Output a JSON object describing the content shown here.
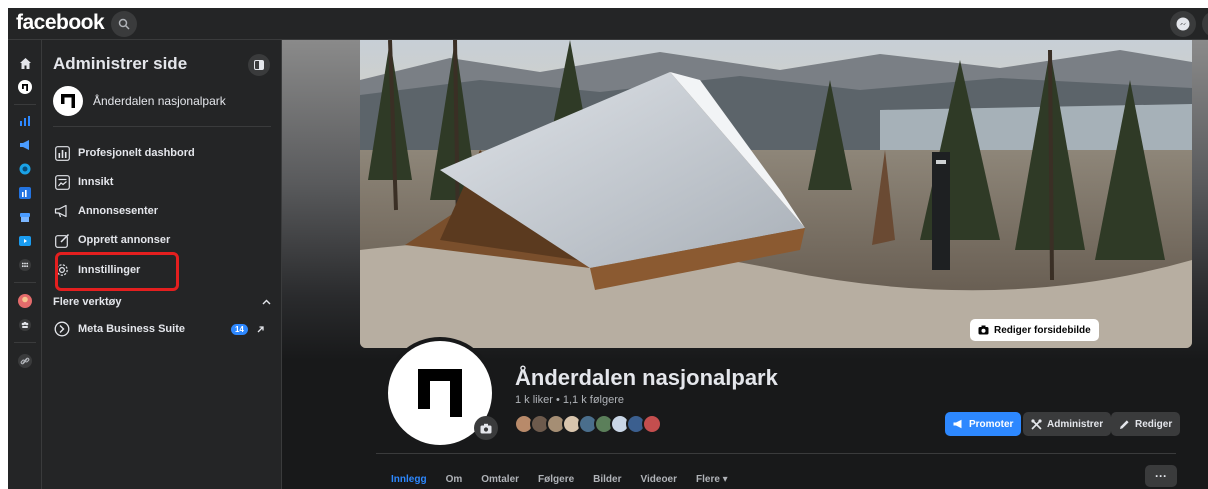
{
  "topbar": {
    "logo": "facebook"
  },
  "panel": {
    "title": "Administrer side",
    "page_name": "Ånderdalen nasjonalpark",
    "menu": [
      {
        "label": "Profesjonelt dashbord",
        "icon": "dashboard-icon"
      },
      {
        "label": "Innsikt",
        "icon": "insights-icon"
      },
      {
        "label": "Annonsesenter",
        "icon": "megaphone-icon"
      },
      {
        "label": "Opprett annonser",
        "icon": "edit-icon"
      },
      {
        "label": "Innstillinger",
        "icon": "gear-icon"
      }
    ],
    "section_title": "Flere verktøy",
    "tools": [
      {
        "label": "Meta Business Suite",
        "badge": "14"
      }
    ]
  },
  "profile": {
    "name": "Ånderdalen nasjonalpark",
    "stats": "1 k liker • 1,1 k følgere",
    "edit_cover_label": "Rediger forsidebilde",
    "actions": {
      "promote": "Promoter",
      "manage": "Administrer",
      "edit": "Rediger"
    }
  },
  "tabs": [
    "Innlegg",
    "Om",
    "Omtaler",
    "Følgere",
    "Bilder",
    "Videoer",
    "Flere ▾"
  ],
  "more_button": "···",
  "colors": {
    "accent": "#2d88ff",
    "highlight": "#e41f1f",
    "background": "#18191a",
    "surface": "#242526"
  }
}
